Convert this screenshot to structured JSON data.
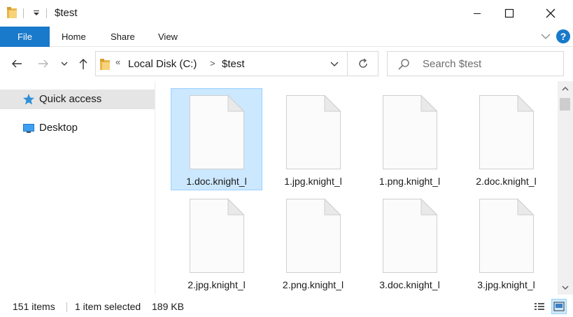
{
  "window": {
    "title": "$test"
  },
  "ribbon": {
    "file": "File",
    "tabs": [
      "Home",
      "Share",
      "View"
    ],
    "help": "?"
  },
  "address": {
    "overflow": "«",
    "parts": [
      "Local Disk (C:)",
      "$test"
    ],
    "separator": ">"
  },
  "search": {
    "placeholder": "Search $test"
  },
  "sidebar": {
    "items": [
      {
        "label": "Quick access",
        "icon": "star-icon"
      },
      {
        "label": "Desktop",
        "icon": "desktop-icon"
      }
    ]
  },
  "files": [
    {
      "name": "1.doc.knight_l",
      "selected": true
    },
    {
      "name": "1.jpg.knight_l",
      "selected": false
    },
    {
      "name": "1.png.knight_l",
      "selected": false
    },
    {
      "name": "2.doc.knight_l",
      "selected": false
    },
    {
      "name": "2.jpg.knight_l",
      "selected": false
    },
    {
      "name": "2.png.knight_l",
      "selected": false
    },
    {
      "name": "3.doc.knight_l",
      "selected": false
    },
    {
      "name": "3.jpg.knight_l",
      "selected": false
    }
  ],
  "status": {
    "items_count": "151 items",
    "selection": "1 item selected",
    "size": "189 KB"
  },
  "colors": {
    "accent": "#1979ca",
    "selection": "#cce8ff",
    "selection_border": "#99d1ff"
  }
}
